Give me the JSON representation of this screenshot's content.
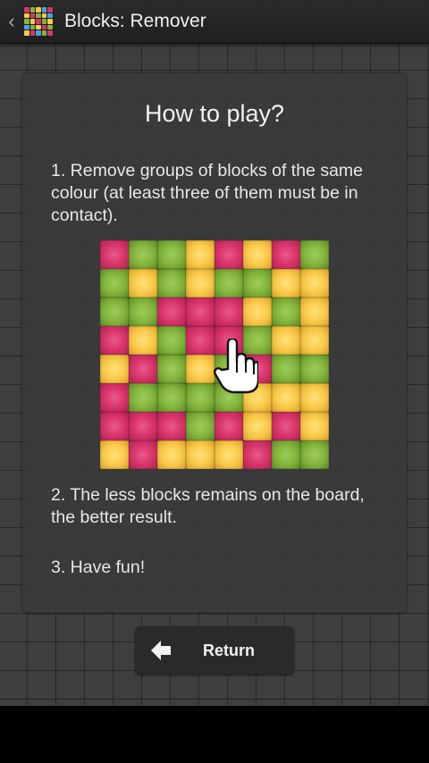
{
  "actionbar": {
    "title": "Blocks: Remover",
    "back_icon": "chevron-left-icon",
    "app_icon": "blocks-app-icon"
  },
  "card": {
    "heading": "How to play?",
    "step1": "1. Remove groups of blocks of the same colour (at least three of them must be in contact).",
    "step2": "2. The less blocks remains on the board, the better result.",
    "step3": "3. Have fun!"
  },
  "board": {
    "rows": [
      [
        "r",
        "g",
        "g",
        "y",
        "r",
        "y",
        "r",
        "g"
      ],
      [
        "g",
        "y",
        "g",
        "y",
        "g",
        "g",
        "y",
        "y"
      ],
      [
        "g",
        "g",
        "r",
        "r",
        "r",
        "y",
        "g",
        "y"
      ],
      [
        "r",
        "y",
        "g",
        "r",
        "r",
        "g",
        "y",
        "y"
      ],
      [
        "y",
        "r",
        "g",
        "y",
        "g",
        "r",
        "g",
        "g"
      ],
      [
        "r",
        "g",
        "g",
        "g",
        "g",
        "y",
        "y",
        "y"
      ],
      [
        "r",
        "r",
        "r",
        "g",
        "r",
        "y",
        "r",
        "y"
      ],
      [
        "y",
        "r",
        "y",
        "y",
        "y",
        "r",
        "g",
        "g"
      ]
    ],
    "colors": {
      "r": "#d8336a",
      "g": "#82b43d",
      "y": "#f9c949"
    },
    "cursor_icon": "hand-pointer-icon"
  },
  "return_button": {
    "label": "Return",
    "icon": "arrow-left-icon"
  }
}
